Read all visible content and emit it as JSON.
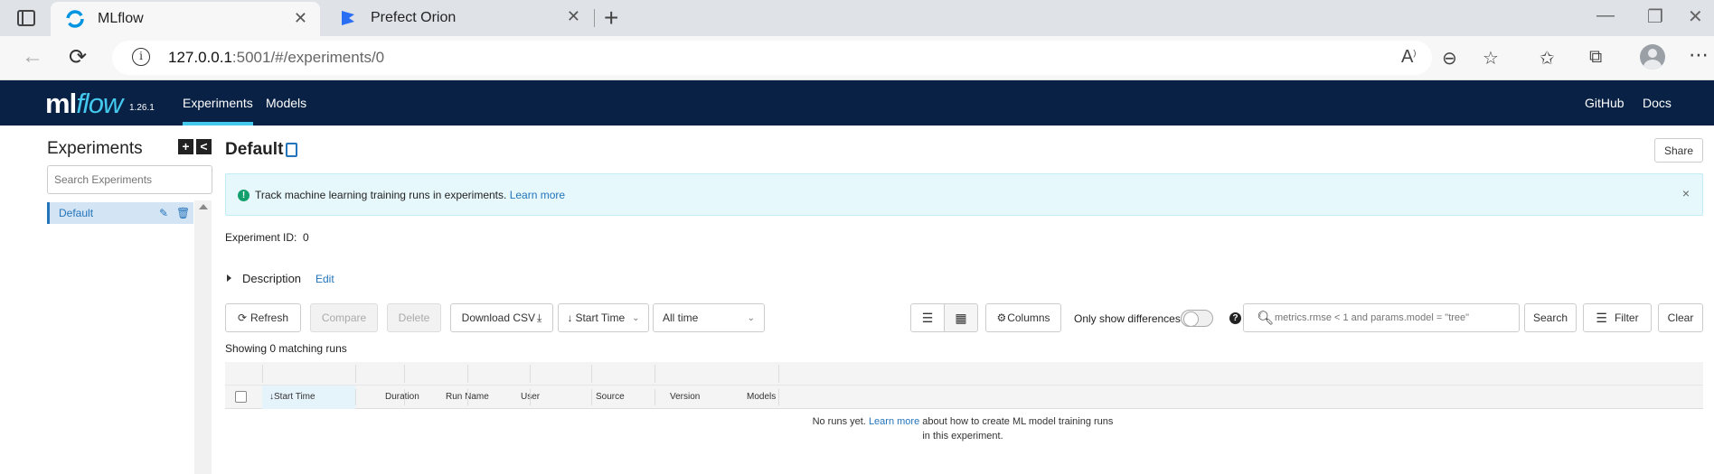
{
  "browser": {
    "tabs": [
      {
        "title": "MLflow",
        "active": true
      },
      {
        "title": "Prefect Orion",
        "active": false
      }
    ],
    "url_host": "127.0.0.1",
    "url_rest": ":5001/#/experiments/0"
  },
  "header": {
    "logo_ml": "ml",
    "logo_flow": "flow",
    "version": "1.26.1",
    "nav": [
      "Experiments",
      "Models"
    ],
    "right_links": [
      "GitHub",
      "Docs"
    ],
    "colors": {
      "header_bg": "#082145",
      "accent": "#43c9ed",
      "link": "#2374bb"
    }
  },
  "sidebar": {
    "title": "Experiments",
    "add_label": "+",
    "collapse_label": "<",
    "search_placeholder": "Search Experiments",
    "items": [
      {
        "label": "Default",
        "selected": true
      }
    ]
  },
  "main": {
    "title": "Default",
    "share_label": "Share",
    "banner": {
      "text": "Track machine learning training runs in experiments.",
      "link": "Learn more",
      "close": "×"
    },
    "experiment_id_label": "Experiment ID:",
    "experiment_id": "0",
    "description_label": "Description",
    "description_edit": "Edit",
    "toolbar": {
      "refresh": "Refresh",
      "compare": "Compare",
      "delete": "Delete",
      "download_csv": "Download CSV",
      "sort_by": "Start Time",
      "time_range": "All time",
      "columns": "Columns",
      "only_diff": "Only show differences",
      "search_placeholder": "metrics.rmse < 1 and params.model = \"tree\"",
      "search": "Search",
      "filter": "Filter",
      "clear": "Clear"
    },
    "showing": "Showing 0 matching runs",
    "table": {
      "columns": [
        "Start Time",
        "Duration",
        "Run Name",
        "User",
        "Source",
        "Version",
        "Models"
      ],
      "empty_pre": "No runs yet.",
      "empty_link": "Learn more",
      "empty_post": "about how to create ML model training runs in this experiment."
    }
  }
}
